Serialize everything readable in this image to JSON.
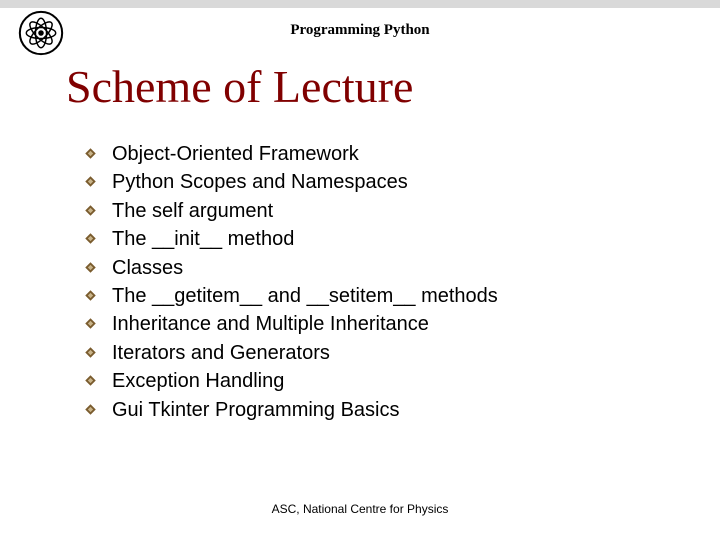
{
  "header": {
    "subject": "Programming Python"
  },
  "title": "Scheme of Lecture",
  "bullets": [
    "Object-Oriented Framework",
    "Python Scopes and Namespaces",
    "The self argument",
    "The __init__ method",
    "Classes",
    "The __getitem__ and __setitem__ methods",
    "Inheritance and Multiple Inheritance",
    "Iterators and Generators",
    "Exception Handling",
    "Gui Tkinter Programming Basics"
  ],
  "footer": "ASC, National Centre for Physics",
  "colors": {
    "title": "#800000",
    "bullet_icon": "#7a5c2e",
    "header_bar": "#d9d9d9"
  }
}
